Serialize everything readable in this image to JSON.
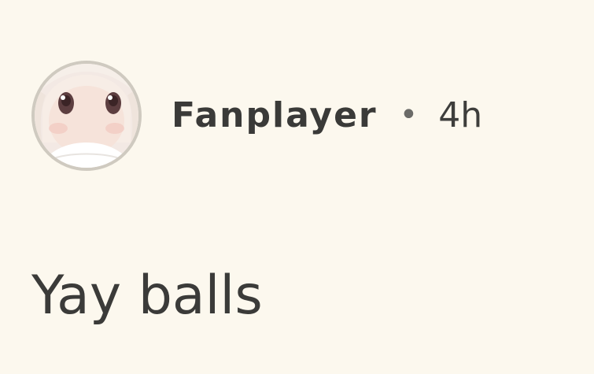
{
  "comment": {
    "author": "Fanplayer",
    "separator": "•",
    "timestamp": "4h",
    "text": "Yay balls"
  },
  "avatar": {
    "icon": "anime-avatar-icon"
  }
}
